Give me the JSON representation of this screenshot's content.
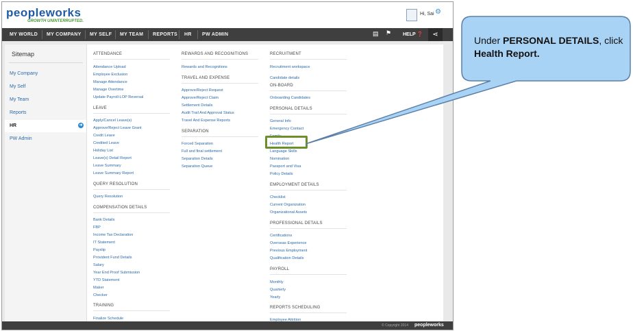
{
  "app": {
    "logo": "peopleworks",
    "tagline": "GROWTH UNINTERRUPTED."
  },
  "header": {
    "greeting": "Hi, Sai",
    "settings_icon": "gear-icon",
    "avatar_icon": "avatar-icon"
  },
  "nav": {
    "items": [
      "MY WORLD",
      "MY COMPANY",
      "MY SELF",
      "MY TEAM",
      "REPORTS",
      "HR",
      "PW ADMIN"
    ],
    "book_icon": "book-icon",
    "flag_icon": "flag-icon",
    "help": "HELP",
    "help_icon": "question-icon",
    "share_icon": "share-icon"
  },
  "sidebar": {
    "title": "Sitemap",
    "items": [
      "My Company",
      "My Self",
      "My Team",
      "Reports",
      "HR",
      "PW Admin"
    ],
    "active": "HR"
  },
  "sitemap": {
    "col1": {
      "attendance": {
        "title": "ATTENDANCE",
        "links": [
          "Attendance Upload",
          "Employee Exclusion",
          "Manage Attendance",
          "Manage Overtime",
          "Update Payroll-LOP Reversal"
        ]
      },
      "leave": {
        "title": "LEAVE",
        "links": [
          "Apply/Cancel Leave(s)",
          "Approve/Reject Leave Grant",
          "Credit Leave",
          "Credited Leave",
          "Holiday List",
          "Leave(s) Detail Report",
          "Leave Summary",
          "Leave Summary Report"
        ]
      },
      "query": {
        "title": "QUERY RESOLUTION",
        "links": [
          "Query Resolution"
        ]
      },
      "comp": {
        "title": "COMPENSATION DETAILS",
        "links": [
          "Bank Details",
          "FBP",
          "Income Tax Declaration",
          "IT Statement",
          "Payslip",
          "Provident Fund Details",
          "Salary",
          "Year End Proof Submission",
          "YTD Statement",
          "Maker",
          "Checker"
        ]
      },
      "training": {
        "title": "TRAINING",
        "links": [
          "Finalize Schedule"
        ]
      }
    },
    "col2": {
      "rewards": {
        "title": "REWARDS AND RECOGNITIONS",
        "links": [
          "Rewards and Recognitions"
        ]
      },
      "travel": {
        "title": "TRAVEL AND EXPENSE",
        "links": [
          "Approve/Reject Request",
          "Approve/Reject Claim",
          "Settlement Details",
          "Audit Trail And Approval Status",
          "Travel And Expense Reports"
        ]
      },
      "separation": {
        "title": "SEPARATION",
        "links": [
          "Forced Separation",
          "Full and final settlement",
          "Separation Details",
          "Separation Queue"
        ]
      }
    },
    "col3": {
      "recruitment": {
        "title": "RECRUITMENT",
        "links": [
          "Recruitment workspace",
          "Candidate details"
        ]
      },
      "onboard": {
        "title": "ON-BOARD",
        "links": [
          "Onboarding Candidates"
        ]
      },
      "personal": {
        "title": "PERSONAL DETAILS",
        "links": [
          "General Info",
          "Emergency Contact",
          "Family",
          "Health Report",
          "Language Skills",
          "Nomination",
          "Passport and Visa",
          "Policy Details"
        ]
      },
      "employment": {
        "title": "EMPLOYMENT DETAILS",
        "links": [
          "Checklist",
          "Current Organization",
          "Organizational Assets"
        ]
      },
      "professional": {
        "title": "PROFESSIONAL DETAILS",
        "links": [
          "Certifications",
          "Overseas Experience",
          "Previous Employment",
          "Qualification Details"
        ]
      },
      "payroll": {
        "title": "PAYROLL",
        "links": [
          "Monthly",
          "Quarterly",
          "Yearly"
        ]
      },
      "reports_sched": {
        "title": "REPORTS SCHEDULING",
        "links": [
          "Employee Attrition"
        ]
      }
    }
  },
  "footer": {
    "copyright": "© Copyright 2014",
    "logo": "peopleworks"
  },
  "callout": {
    "prefix": "Under ",
    "section": "PERSONAL DETAILS",
    "mid": ", click ",
    "target": "Health Report",
    "suffix": "."
  },
  "colors": {
    "nav_bg": "#3f3f3f",
    "link": "#2a6aa8",
    "highlight": "#6b8f2a",
    "callout_fill": "#a9d3f5",
    "callout_border": "#5a7fa8"
  }
}
